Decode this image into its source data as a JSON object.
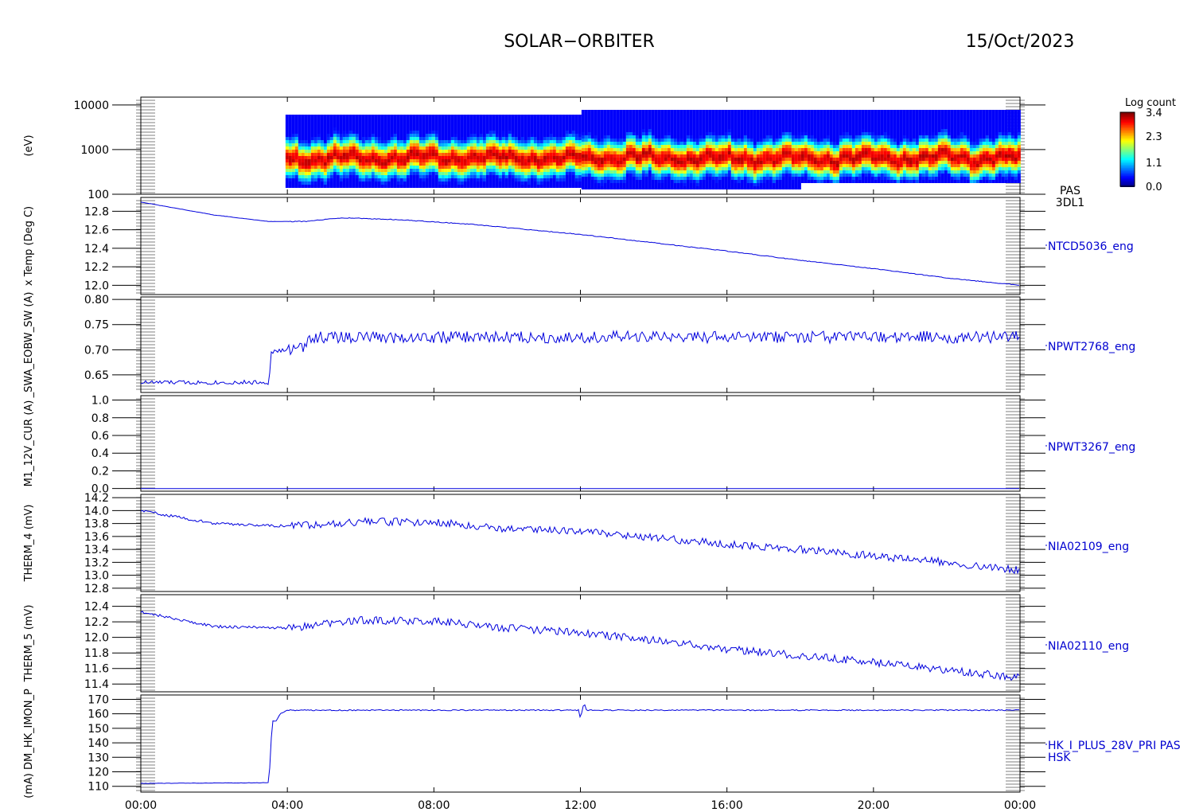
{
  "header": {
    "mission": "SOLAR−ORBITER",
    "date": "15/Oct/2023"
  },
  "colors": {
    "line": "#0000dd",
    "axis": "#000000",
    "text_label": "#0000d0"
  },
  "chart_data": [
    {
      "type": "heatmap",
      "panel": "spectrogram",
      "ylabel": "(eV)",
      "yscale": "log",
      "ylim": [
        100,
        15000
      ],
      "yticks": [
        "10000",
        "1000",
        "100"
      ],
      "ytick_values": [
        10000,
        1000,
        100
      ],
      "label_lines": [
        "PAS",
        "3DL1"
      ],
      "data_start_hour": 3.95,
      "peak_energy_ev": 700,
      "colorbar": {
        "title": "Log count",
        "ticks": [
          "3.4",
          "2.3",
          "1.1",
          "0.0"
        ],
        "range": [
          0.0,
          3.4
        ]
      }
    },
    {
      "type": "line",
      "panel": "ntcd5036",
      "series_label": "NTCD5036_eng",
      "ylabel": "x Temp (Deg C)",
      "ylim": [
        11.9,
        12.95
      ],
      "yticks": [
        "12.8",
        "12.6",
        "12.4",
        "12.2",
        "12.0"
      ],
      "ytick_values": [
        12.8,
        12.6,
        12.4,
        12.2,
        12.0
      ],
      "x": [
        0,
        2,
        3.5,
        4.5,
        5.5,
        7,
        9,
        12,
        14,
        16,
        18,
        20,
        22,
        24
      ],
      "values": [
        12.9,
        12.76,
        12.69,
        12.69,
        12.73,
        12.71,
        12.66,
        12.55,
        12.46,
        12.37,
        12.27,
        12.18,
        12.08,
        12.0
      ]
    },
    {
      "type": "line",
      "panel": "npwt2768",
      "series_label": "NPWT2768_eng",
      "ylabel": "_SWA_EOBW_SW (A)",
      "ylim": [
        0.615,
        0.805
      ],
      "yticks": [
        "0.80",
        "0.75",
        "0.70",
        "0.65"
      ],
      "ytick_values": [
        0.8,
        0.75,
        0.7,
        0.65
      ],
      "x": [
        0,
        3.5,
        3.55,
        4.5,
        4.6,
        24
      ],
      "values": [
        0.635,
        0.635,
        0.695,
        0.705,
        0.725,
        0.725
      ]
    },
    {
      "type": "line",
      "panel": "npwt3267",
      "series_label": "NPWT3267_eng",
      "ylabel": "M1_12V_CUR (A)",
      "ylim": [
        -0.03,
        1.05
      ],
      "yticks": [
        "1.0",
        "0.8",
        "0.6",
        "0.4",
        "0.2",
        "0.0"
      ],
      "ytick_values": [
        1.0,
        0.8,
        0.6,
        0.4,
        0.2,
        0.0
      ],
      "x": [
        0,
        24
      ],
      "values": [
        0.0,
        0.0
      ]
    },
    {
      "type": "line",
      "panel": "nia02109",
      "series_label": "NIA02109_eng",
      "ylabel": "THERM_4 (mV)",
      "ylim": [
        12.75,
        14.25
      ],
      "yticks": [
        "14.2",
        "14.0",
        "13.8",
        "13.6",
        "13.4",
        "13.2",
        "13.0",
        "12.8"
      ],
      "ytick_values": [
        14.2,
        14.0,
        13.8,
        13.6,
        13.4,
        13.2,
        13.0,
        12.8
      ],
      "x": [
        0,
        2,
        4,
        6,
        8,
        10,
        12,
        14,
        16,
        18,
        20,
        22,
        24
      ],
      "values": [
        14.0,
        13.8,
        13.76,
        13.83,
        13.82,
        13.72,
        13.69,
        13.58,
        13.48,
        13.4,
        13.3,
        13.2,
        13.08
      ]
    },
    {
      "type": "line",
      "panel": "nia02110",
      "series_label": "NIA02110_eng",
      "ylabel": "THERM_5 (mV)",
      "ylim": [
        11.3,
        12.55
      ],
      "yticks": [
        "12.4",
        "12.2",
        "12.0",
        "11.8",
        "11.6",
        "11.4"
      ],
      "ytick_values": [
        12.4,
        12.2,
        12.0,
        11.8,
        11.6,
        11.4
      ],
      "x": [
        0,
        2,
        4,
        6,
        8,
        10,
        12,
        14,
        16,
        18,
        20,
        22,
        24
      ],
      "values": [
        12.33,
        12.14,
        12.12,
        12.22,
        12.21,
        12.12,
        12.06,
        11.96,
        11.85,
        11.77,
        11.68,
        11.58,
        11.48
      ]
    },
    {
      "type": "line",
      "panel": "hsk",
      "series_label": "HK_I_PLUS_28V_PRI PAS",
      "series_label_2": "HSK",
      "ylabel": "(mA) DM_HK_IMON_P",
      "ylim": [
        106,
        173
      ],
      "yticks": [
        "170",
        "160",
        "150",
        "140",
        "130",
        "120",
        "110"
      ],
      "ytick_values": [
        170,
        160,
        150,
        140,
        130,
        120,
        110
      ],
      "x": [
        0,
        3.5,
        3.55,
        3.6,
        3.7,
        3.8,
        4.0,
        11.95,
        12.0,
        12.1,
        12.15,
        12.2,
        24
      ],
      "values": [
        112,
        112.5,
        140,
        155,
        155,
        160,
        162.5,
        162.5,
        157,
        168,
        162.5,
        162.5,
        162.5
      ]
    }
  ],
  "xaxis": {
    "tick_labels": [
      "00:00",
      "04:00",
      "08:00",
      "12:00",
      "16:00",
      "20:00",
      "00:00"
    ],
    "tick_hours": [
      0,
      4,
      8,
      12,
      16,
      20,
      24
    ],
    "range_hours": [
      0,
      24
    ]
  }
}
